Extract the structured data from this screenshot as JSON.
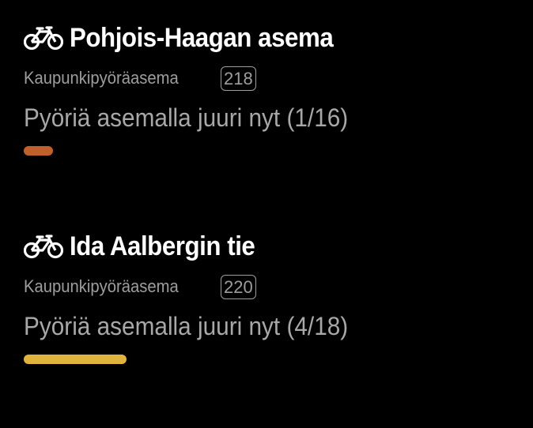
{
  "stations": [
    {
      "name": "Pohjois-Haagan asema",
      "type": "Kaupunkipyöräasema",
      "id": "218",
      "availability_text": "Pyöriä asemalla juuri nyt (1/16)",
      "bikes_available": 1,
      "capacity": 16,
      "bar_color": "#c0602a"
    },
    {
      "name": "Ida Aalbergin tie",
      "type": "Kaupunkipyöräasema",
      "id": "220",
      "availability_text": "Pyöriä asemalla juuri nyt (4/18)",
      "bikes_available": 4,
      "capacity": 18,
      "bar_color": "#e0b43c"
    }
  ],
  "icons": {
    "station_icon": "bicycle-icon"
  },
  "colors": {
    "background": "#000000",
    "title": "#ffffff",
    "secondary_text": "#9e9e9e"
  }
}
